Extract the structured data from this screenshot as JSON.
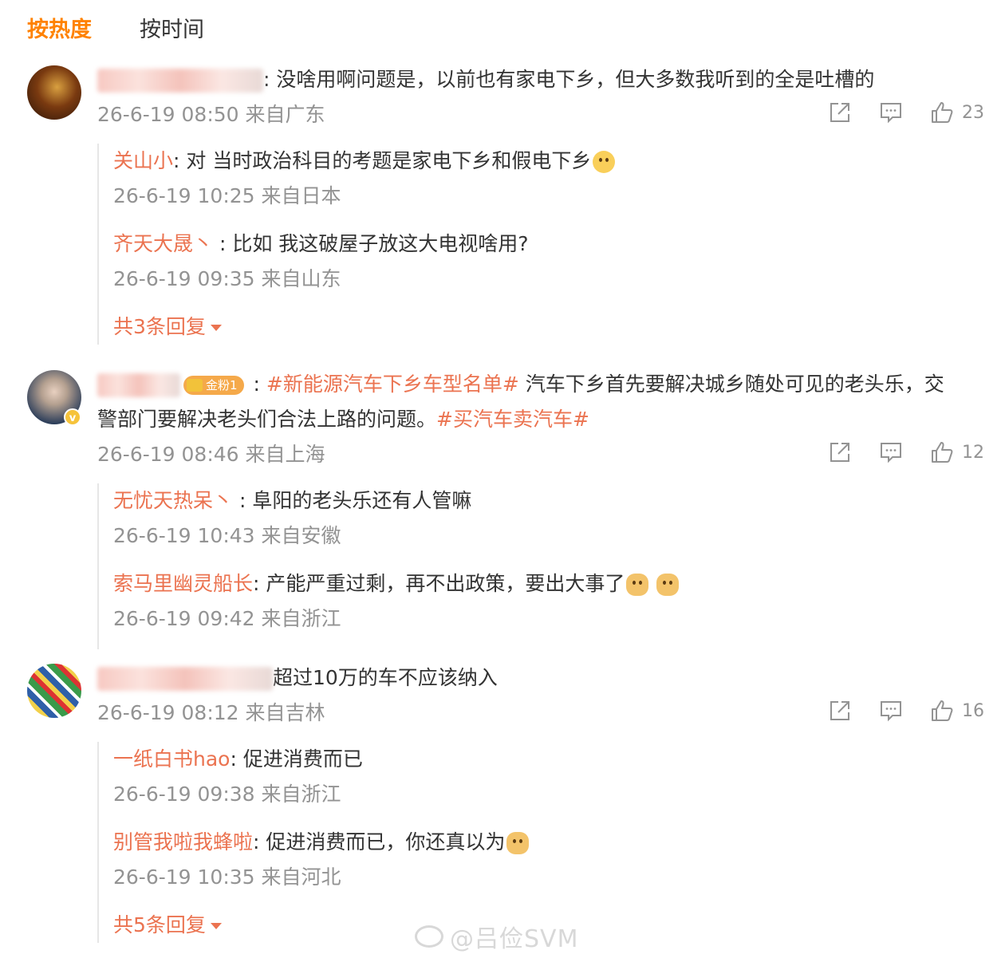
{
  "tabs": {
    "hot": "按热度",
    "time": "按时间"
  },
  "comments": [
    {
      "text": ": 没啥用啊问题是，以前也有家电下乡，但大多数我听到的全是吐槽的",
      "meta": "26-6-19 08:50 来自广东",
      "likes": "23",
      "replies": [
        {
          "user": "关山小",
          "text": ": 对 当时政治科目的考题是家电下乡和假电下乡",
          "meta": "26-6-19 10:25 来自日本"
        },
        {
          "user": "齐天大晟丶",
          "text": " : 比如  我这破屋子放这大电视啥用?",
          "meta": "26-6-19 09:35 来自山东"
        }
      ],
      "more": "共3条回复"
    },
    {
      "fan_badge": "金粉1",
      "colon": " : ",
      "tag1": "#新能源汽车下乡车型名单#",
      "text1": " 汽车下乡首先要解决城乡随处可见的老头乐，交",
      "text2": "警部门要解决老头们合法上路的问题。",
      "tag2": "#买汽车卖汽车#",
      "meta": "26-6-19 08:46 来自上海",
      "likes": "12",
      "replies": [
        {
          "user": "无忧天热呆丶",
          "text": " : 阜阳的老头乐还有人管嘛",
          "meta": "26-6-19 10:43 来自安徽"
        },
        {
          "user": "索马里幽灵船长",
          "text": ": 产能严重过剩，再不出政策，要出大事了",
          "meta": "26-6-19 09:42 来自浙江"
        }
      ]
    },
    {
      "text": "超过10万的车不应该纳入",
      "meta": "26-6-19 08:12 来自吉林",
      "likes": "16",
      "replies": [
        {
          "user": "一纸白书hao",
          "text": ": 促进消费而已",
          "meta": "26-6-19 09:38 来自浙江"
        },
        {
          "user": "别管我啦我蜂啦",
          "text": ": 促进消费而已，你还真以为",
          "meta": "26-6-19 10:35 来自河北"
        }
      ],
      "more": "共5条回复"
    }
  ],
  "watermark": "@吕俭SVM",
  "colors": {
    "accent": "#ff8200",
    "username": "#eb7350",
    "meta": "#939393"
  }
}
